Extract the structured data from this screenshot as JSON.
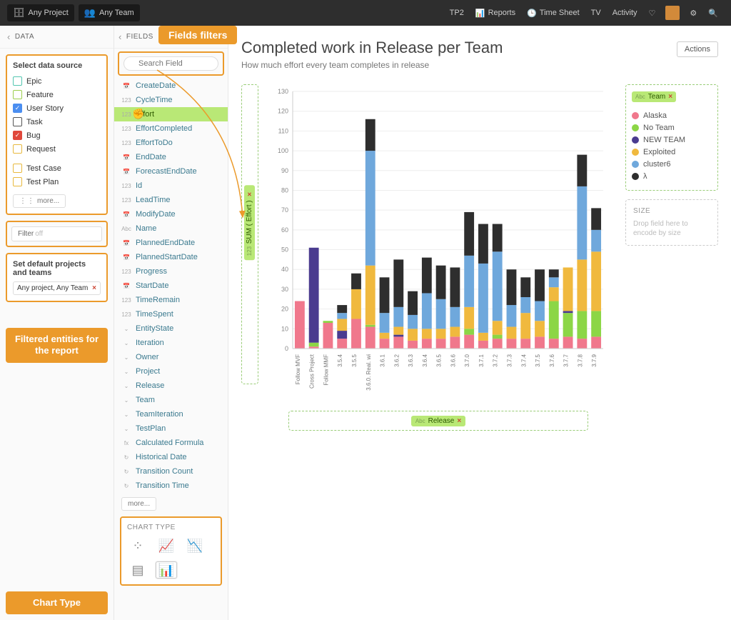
{
  "topbar": {
    "project_btn": "Any Project",
    "team_btn": "Any Team",
    "nav": {
      "tp2": "TP2",
      "reports": "Reports",
      "timesheet": "Time Sheet",
      "tv": "TV",
      "activity": "Activity"
    }
  },
  "annotations": {
    "fields_filters": "Fields filters",
    "filtered_entities": "Filtered entities for the report",
    "chart_type": "Chart Type"
  },
  "data_panel": {
    "header": "DATA",
    "select_source_title": "Select data source",
    "sources": [
      {
        "label": "Epic",
        "color": "#53c6b0",
        "checked": false
      },
      {
        "label": "Feature",
        "color": "#9dcf4e",
        "checked": false
      },
      {
        "label": "User Story",
        "color": "#4b8ef0",
        "checked": true
      },
      {
        "label": "Task",
        "color": "#555555",
        "checked": false
      },
      {
        "label": "Bug",
        "color": "#e0483c",
        "checked": true
      },
      {
        "label": "Request",
        "color": "#e8b93e",
        "checked": false
      }
    ],
    "sources2": [
      {
        "label": "Test Case",
        "color": "#e8b93e",
        "checked": false
      },
      {
        "label": "Test Plan",
        "color": "#e8b93e",
        "checked": false
      }
    ],
    "more_btn": "more...",
    "filter_btn": "Filter",
    "filter_off": "off",
    "default_title": "Set default projects and teams",
    "proj_sel": "Any project, Any Team"
  },
  "fields_panel": {
    "header": "FIELDS",
    "filter_types": [
      "123",
      "Abc",
      "📅"
    ],
    "search_placeholder": "Search Field",
    "fields": [
      {
        "type": "📅",
        "name": "CreateDate"
      },
      {
        "type": "123",
        "name": "CycleTime"
      },
      {
        "type": "123",
        "name": "Effort",
        "selected": true
      },
      {
        "type": "123",
        "name": "EffortCompleted"
      },
      {
        "type": "123",
        "name": "EffortToDo"
      },
      {
        "type": "📅",
        "name": "EndDate"
      },
      {
        "type": "📅",
        "name": "ForecastEndDate"
      },
      {
        "type": "123",
        "name": "Id"
      },
      {
        "type": "123",
        "name": "LeadTime"
      },
      {
        "type": "📅",
        "name": "ModifyDate"
      },
      {
        "type": "Abc",
        "name": "Name"
      },
      {
        "type": "📅",
        "name": "PlannedEndDate"
      },
      {
        "type": "📅",
        "name": "PlannedStartDate"
      },
      {
        "type": "123",
        "name": "Progress"
      },
      {
        "type": "📅",
        "name": "StartDate"
      },
      {
        "type": "123",
        "name": "TimeRemain"
      },
      {
        "type": "123",
        "name": "TimeSpent"
      },
      {
        "type": "⌄",
        "name": "EntityState"
      },
      {
        "type": "⌄",
        "name": "Iteration"
      },
      {
        "type": "⌄",
        "name": "Owner"
      },
      {
        "type": "⌄",
        "name": "Project"
      },
      {
        "type": "⌄",
        "name": "Release"
      },
      {
        "type": "⌄",
        "name": "Team"
      },
      {
        "type": "⌄",
        "name": "TeamIteration"
      },
      {
        "type": "⌄",
        "name": "TestPlan"
      },
      {
        "type": "fx",
        "name": "Calculated Formula"
      },
      {
        "type": "↻",
        "name": "Historical Date"
      },
      {
        "type": "↻",
        "name": "Transition Count"
      },
      {
        "type": "↻",
        "name": "Transition Time"
      }
    ],
    "more_btn": "more...",
    "chart_type_title": "CHART TYPE"
  },
  "main": {
    "title": "Completed work in Release per Team",
    "subtitle": "How much effort every team completes in release",
    "actions_btn": "Actions",
    "y_encoding": "SUM ( Effort )",
    "x_encoding": "Release",
    "color_encoding": "Team",
    "size_drop_title": "SIZE",
    "size_drop_hint": "Drop field here to encode by size"
  },
  "legend": {
    "series": [
      {
        "name": "Alaska",
        "color": "#f0788c"
      },
      {
        "name": "No Team",
        "color": "#8cd646"
      },
      {
        "name": "NEW TEAM",
        "color": "#4a3b8f"
      },
      {
        "name": "Exploited",
        "color": "#f0b93e"
      },
      {
        "name": "cluster6",
        "color": "#6fa8dc"
      },
      {
        "name": "λ",
        "color": "#2e2e2e"
      }
    ]
  },
  "chart_data": {
    "type": "bar",
    "title": "Completed work in Release per Team",
    "xlabel": "Release",
    "ylabel": "SUM ( Effort )",
    "ylim": [
      0,
      130
    ],
    "categories": [
      "Follow MVF",
      "Cross Project",
      "Follow MMF",
      "3.5.4",
      "3.5.5",
      "3.6.0. Real. wi",
      "3.6.1",
      "3.6.2",
      "3.6.3",
      "3.6.4",
      "3.6.5",
      "3.6.6",
      "3.7.0",
      "3.7.1",
      "3.7.2",
      "3.7.3",
      "3.7.4",
      "3.7.5",
      "3.7.6",
      "3.7.7",
      "3.7.8",
      "3.7.9"
    ],
    "series": [
      {
        "name": "Alaska",
        "color": "#f0788c",
        "values": [
          24,
          1,
          13,
          5,
          15,
          11,
          5,
          6,
          4,
          5,
          5,
          6,
          7,
          4,
          5,
          5,
          5,
          6,
          5,
          6,
          5,
          6
        ]
      },
      {
        "name": "No Team",
        "color": "#8cd646",
        "values": [
          0,
          2,
          1,
          0,
          0,
          1,
          0,
          0,
          0,
          0,
          0,
          0,
          3,
          0,
          2,
          0,
          0,
          0,
          19,
          12,
          14,
          13
        ]
      },
      {
        "name": "NEW TEAM",
        "color": "#4a3b8f",
        "values": [
          0,
          48,
          0,
          4,
          0,
          0,
          0,
          1,
          0,
          0,
          0,
          0,
          0,
          0,
          0,
          0,
          0,
          0,
          0,
          1,
          0,
          0
        ]
      },
      {
        "name": "Exploited",
        "color": "#f0b93e",
        "values": [
          0,
          0,
          0,
          6,
          15,
          30,
          3,
          4,
          6,
          5,
          5,
          5,
          11,
          4,
          7,
          6,
          13,
          8,
          7,
          22,
          26,
          30
        ]
      },
      {
        "name": "cluster6",
        "color": "#6fa8dc",
        "values": [
          0,
          0,
          0,
          3,
          0,
          58,
          10,
          10,
          7,
          18,
          15,
          10,
          26,
          35,
          35,
          11,
          8,
          10,
          5,
          0,
          37,
          11
        ]
      },
      {
        "name": "λ",
        "color": "#2e2e2e",
        "values": [
          0,
          0,
          0,
          4,
          8,
          16,
          18,
          24,
          12,
          18,
          17,
          20,
          22,
          20,
          14,
          18,
          10,
          16,
          4,
          0,
          16,
          11
        ]
      }
    ]
  }
}
